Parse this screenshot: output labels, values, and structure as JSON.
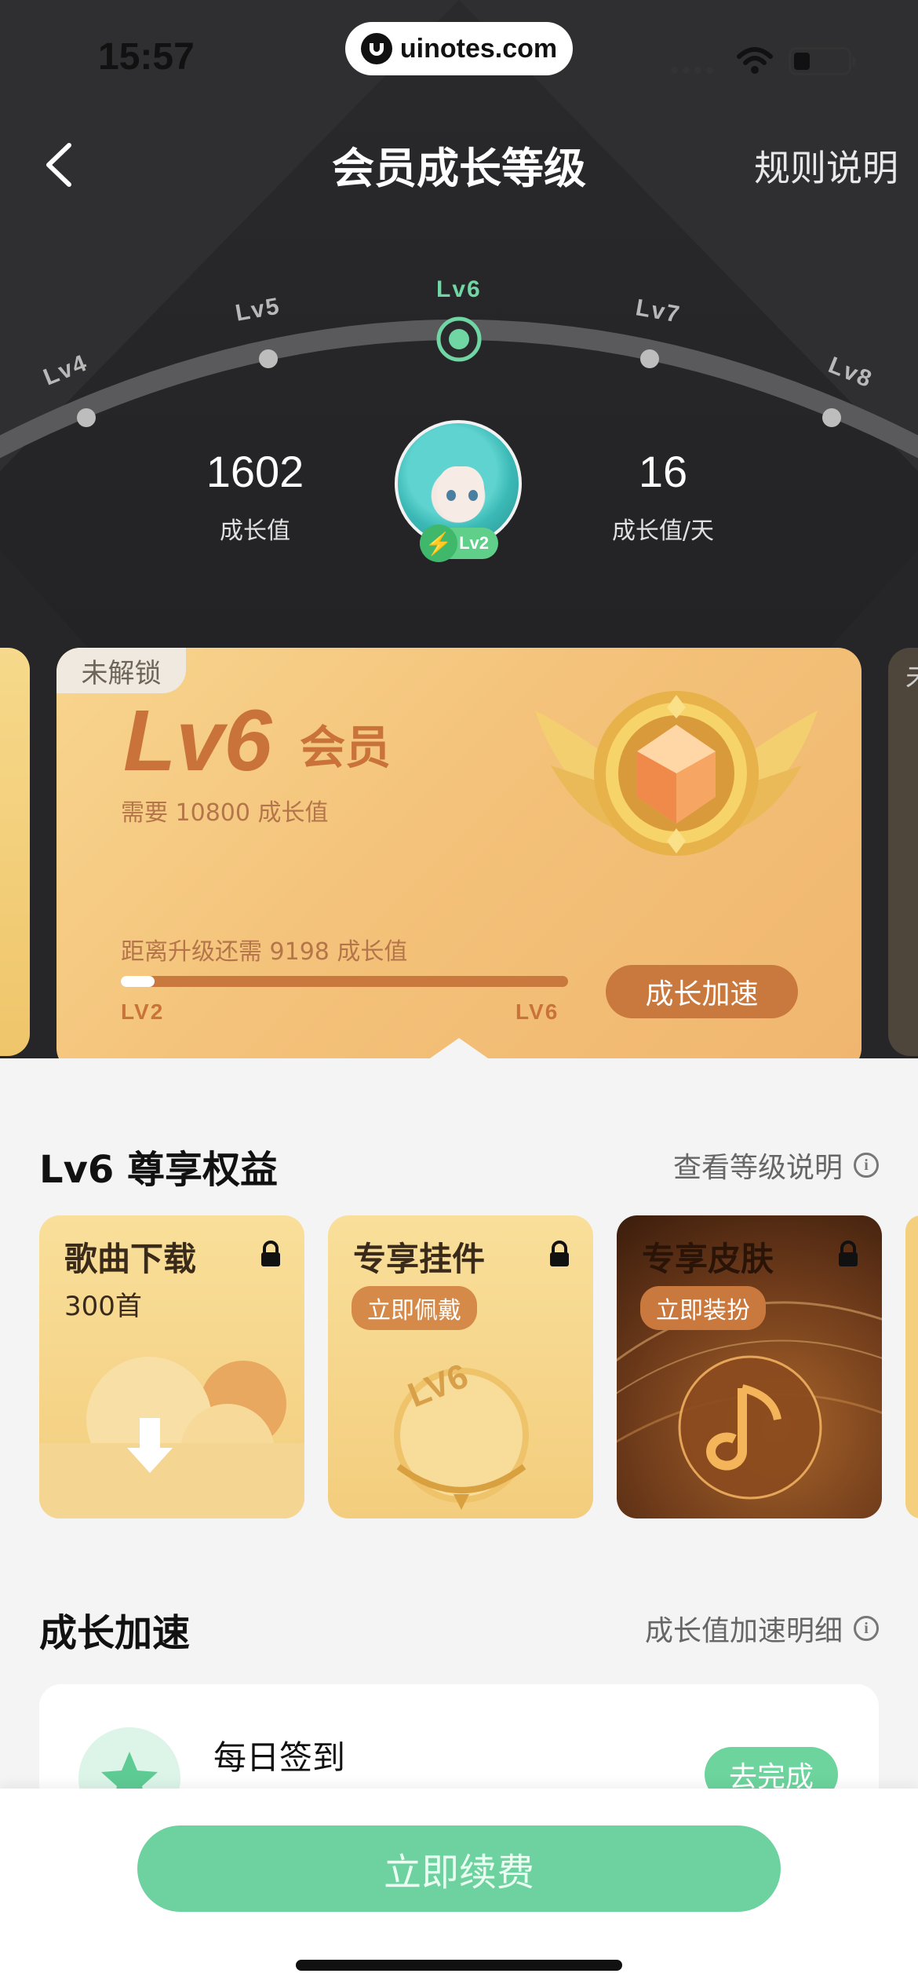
{
  "status_bar": {
    "time": "15:57",
    "watermark": "uinotes.com"
  },
  "header": {
    "title": "会员成长等级",
    "rules_link": "规则说明"
  },
  "levels": [
    "Lv4",
    "Lv5",
    "Lv6",
    "Lv7",
    "Lv8"
  ],
  "current_level_label": "Lv6",
  "stats": {
    "growth_value": "1602",
    "growth_value_label": "成长值",
    "daily_growth": "16",
    "daily_growth_label": "成长值/天"
  },
  "avatar": {
    "badge": "Lv2"
  },
  "level_card": {
    "tag": "未解锁",
    "level": "Lv6",
    "member_label": "会员",
    "requirement": "需要  10800  成长值",
    "distance": "距离升级还需  9198  成长值",
    "progress_fraction": 0.075,
    "progress_start": "LV2",
    "progress_end": "LV6",
    "boost_button": "成长加速"
  },
  "benefits": {
    "title": "Lv6 尊享权益",
    "link": "查看等级说明",
    "items": [
      {
        "name": "歌曲下载",
        "sub": "300首"
      },
      {
        "name": "专享挂件",
        "tag": "立即佩戴"
      },
      {
        "name": "专享皮肤",
        "tag": "立即装扮"
      }
    ]
  },
  "speedup": {
    "title": "成长加速",
    "link": "成长值加速明细",
    "task_name": "每日签到",
    "task_button": "去完成"
  },
  "bottom": {
    "renew_button": "立即续费"
  },
  "colors": {
    "accent_green": "#6dd29f",
    "gold": "#c9733a"
  }
}
